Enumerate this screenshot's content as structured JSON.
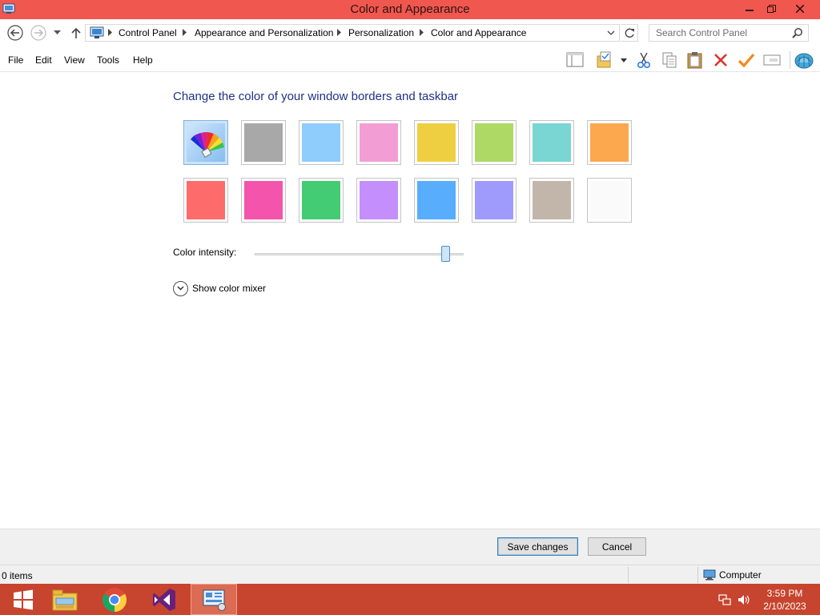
{
  "window": {
    "title": "Color and Appearance",
    "accent": "#f0574f"
  },
  "address": {
    "crumbs": [
      "Control Panel",
      "Appearance and Personalization",
      "Personalization",
      "Color and Appearance"
    ]
  },
  "search": {
    "placeholder": "Search Control Panel"
  },
  "menu": {
    "file": "File",
    "edit": "Edit",
    "view": "View",
    "tools": "Tools",
    "help": "Help"
  },
  "toolbar": {
    "icons": [
      "layout-pane-icon",
      "properties-folder-icon",
      "cut-icon",
      "copy-icon",
      "paste-icon",
      "delete-icon",
      "check-icon",
      "rename-icon",
      "shell-icon"
    ]
  },
  "main": {
    "heading": "Change the color of your window borders and taskbar",
    "swatches": [
      {
        "name": "automatic",
        "color": "#a8d0f5",
        "icon": "color-palette-icon",
        "selected": true
      },
      {
        "name": "gray",
        "color": "#a8a8a8"
      },
      {
        "name": "sky",
        "color": "#8ecdfc"
      },
      {
        "name": "pink",
        "color": "#f29ed4"
      },
      {
        "name": "yellow",
        "color": "#efcf42"
      },
      {
        "name": "lime",
        "color": "#add964"
      },
      {
        "name": "teal",
        "color": "#7ad6d2"
      },
      {
        "name": "orange",
        "color": "#fca84f"
      },
      {
        "name": "red",
        "color": "#fd6b6b"
      },
      {
        "name": "magenta",
        "color": "#f454ac"
      },
      {
        "name": "green",
        "color": "#43cc74"
      },
      {
        "name": "purple",
        "color": "#c48efc"
      },
      {
        "name": "blue",
        "color": "#58aefc"
      },
      {
        "name": "periwinkle",
        "color": "#9f9bfc"
      },
      {
        "name": "taupe",
        "color": "#c2b6aa"
      },
      {
        "name": "white",
        "color": "#fafafa"
      }
    ],
    "intensity_label": "Color intensity:",
    "intensity_value": 0.91,
    "mixer_label": "Show color mixer"
  },
  "buttons": {
    "save": "Save changes",
    "cancel": "Cancel"
  },
  "status": {
    "items": "0 items",
    "location": "Computer"
  },
  "taskbar": {
    "apps": [
      "windows-start-icon",
      "file-explorer-icon",
      "chrome-icon",
      "visual-studio-icon",
      "control-panel-icon"
    ],
    "time": "3:59 PM",
    "date": "2/10/2023"
  }
}
